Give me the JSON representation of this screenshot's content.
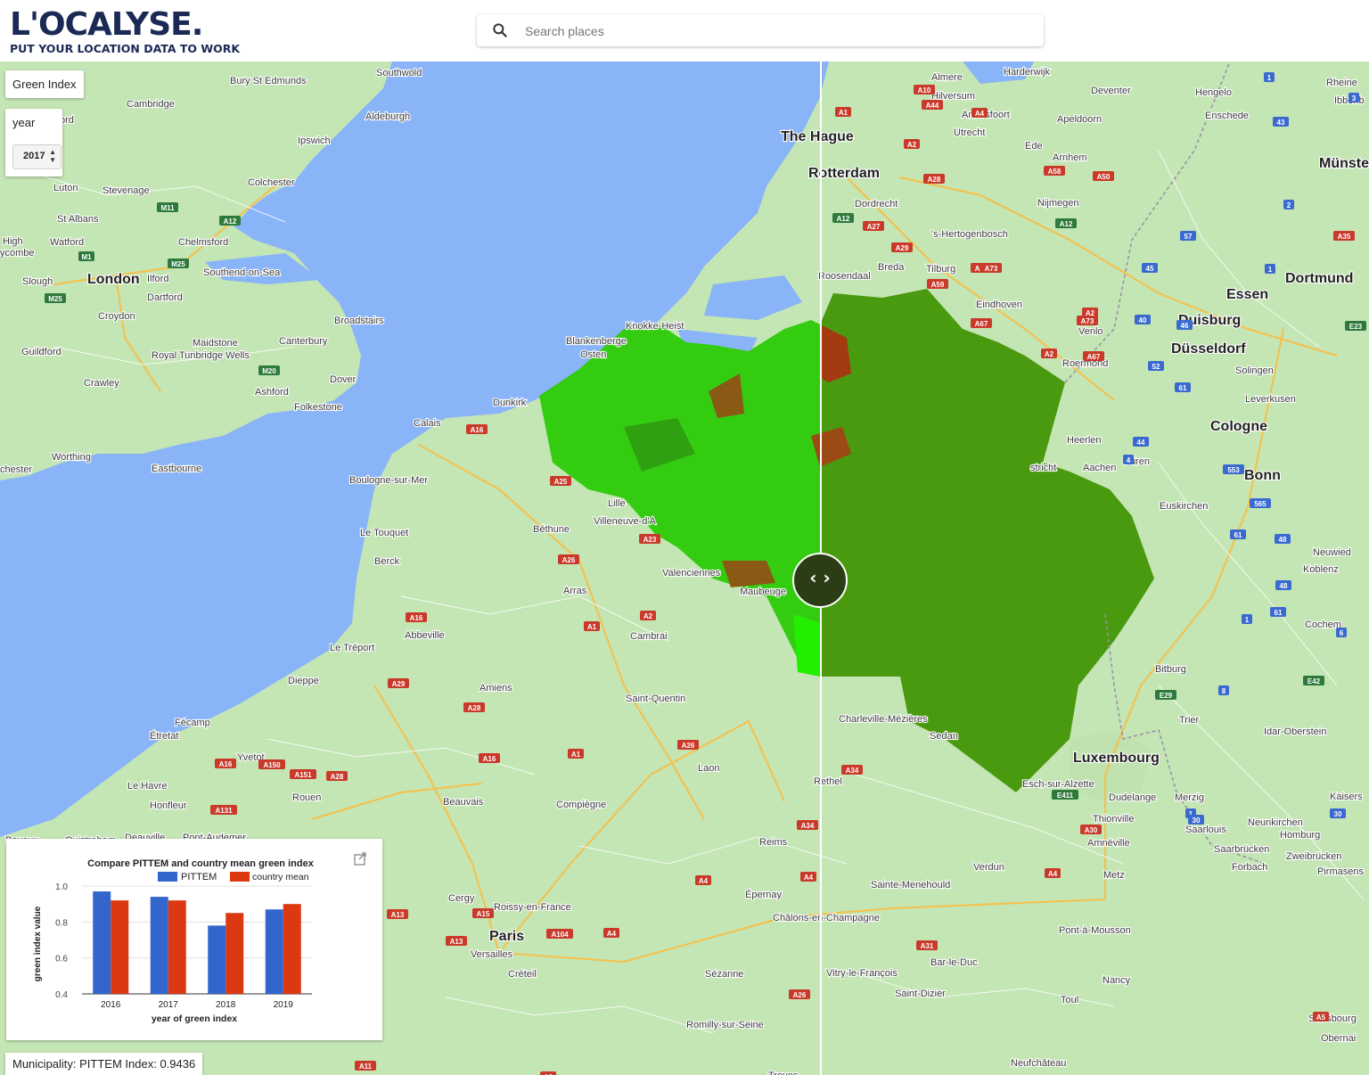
{
  "header": {
    "logo_text": "L'OCALYSE.",
    "tagline": "PUT YOUR LOCATION DATA TO WORK",
    "search_placeholder": "Search places"
  },
  "controls": {
    "layer_label": "Green Index",
    "year_label": "year",
    "year_value": "2017"
  },
  "status": {
    "municipality_text": "Municipality: PITTEM Index: 0.9436"
  },
  "map": {
    "labels": [
      {
        "text": "Cambridge",
        "big": false
      },
      {
        "text": "Bury St Edmunds",
        "big": false
      },
      {
        "text": "Southwold",
        "big": false
      },
      {
        "text": "Aldeburgh",
        "big": false
      },
      {
        "text": "Ipswich",
        "big": false
      },
      {
        "text": "Colchester",
        "big": false
      },
      {
        "text": "Luton",
        "big": false
      },
      {
        "text": "Stevenage",
        "big": false
      },
      {
        "text": "St Albans",
        "big": false
      },
      {
        "text": "Watford",
        "big": false
      },
      {
        "text": "Chelmsford",
        "big": false
      },
      {
        "text": "London",
        "big": true
      },
      {
        "text": "Slough",
        "big": false
      },
      {
        "text": "Ilford",
        "big": false
      },
      {
        "text": "Dartford",
        "big": false
      },
      {
        "text": "Southend-on-Sea",
        "big": false
      },
      {
        "text": "Croydon",
        "big": false
      },
      {
        "text": "Broadstairs",
        "big": false
      },
      {
        "text": "Maidstone",
        "big": false
      },
      {
        "text": "Canterbury",
        "big": false
      },
      {
        "text": "Guildford",
        "big": false
      },
      {
        "text": "Royal Tunbridge Wells",
        "big": false
      },
      {
        "text": "Crawley",
        "big": false
      },
      {
        "text": "Dover",
        "big": false
      },
      {
        "text": "Ashford",
        "big": false
      },
      {
        "text": "Folkestone",
        "big": false
      },
      {
        "text": "Worthing",
        "big": false
      },
      {
        "text": "Eastbourne",
        "big": false
      },
      {
        "text": "Calais",
        "big": false
      },
      {
        "text": "Dunkirk",
        "big": false
      },
      {
        "text": "Boulogne-sur-Mer",
        "big": false
      },
      {
        "text": "Le Touquet",
        "big": false
      },
      {
        "text": "Berck",
        "big": false
      },
      {
        "text": "Lille",
        "big": false
      },
      {
        "text": "Villeneuve-d'A",
        "big": false
      },
      {
        "text": "Béthune",
        "big": false
      },
      {
        "text": "Arras",
        "big": false
      },
      {
        "text": "Valenciennes",
        "big": false
      },
      {
        "text": "Maubeuge",
        "big": false
      },
      {
        "text": "Cambrai",
        "big": false
      },
      {
        "text": "Abbeville",
        "big": false
      },
      {
        "text": "Le Tréport",
        "big": false
      },
      {
        "text": "Dieppe",
        "big": false
      },
      {
        "text": "Amiens",
        "big": false
      },
      {
        "text": "Saint-Quentin",
        "big": false
      },
      {
        "text": "Fécamp",
        "big": false
      },
      {
        "text": "Étretat",
        "big": false
      },
      {
        "text": "Yvetot",
        "big": false
      },
      {
        "text": "Le Havre",
        "big": false
      },
      {
        "text": "Honfleur",
        "big": false
      },
      {
        "text": "Rouen",
        "big": false
      },
      {
        "text": "Beauvais",
        "big": false
      },
      {
        "text": "Compiègne",
        "big": false
      },
      {
        "text": "Laon",
        "big": false
      },
      {
        "text": "Reims",
        "big": false
      },
      {
        "text": "Cergy",
        "big": false
      },
      {
        "text": "Roissy-en-France",
        "big": false
      },
      {
        "text": "Paris",
        "big": true
      },
      {
        "text": "Versailles",
        "big": false
      },
      {
        "text": "Créteil",
        "big": false
      },
      {
        "text": "Épernay",
        "big": false
      },
      {
        "text": "Châlons-en-Champagne",
        "big": false
      },
      {
        "text": "Sézanne",
        "big": false
      },
      {
        "text": "Romilly-sur-Seine",
        "big": false
      },
      {
        "text": "Vitry-le-François",
        "big": false
      },
      {
        "text": "Saint-Dizier",
        "big": false
      },
      {
        "text": "Sainte-Menehould",
        "big": false
      },
      {
        "text": "Verdun",
        "big": false
      },
      {
        "text": "Metz",
        "big": false
      },
      {
        "text": "Pont-à-Mousson",
        "big": false
      },
      {
        "text": "Nancy",
        "big": false
      },
      {
        "text": "Toul",
        "big": false
      },
      {
        "text": "Bar-le-Duc",
        "big": false
      },
      {
        "text": "Sedan",
        "big": false
      },
      {
        "text": "Charleville-Mézières",
        "big": false
      },
      {
        "text": "Rethel",
        "big": false
      },
      {
        "text": "Luxembourg",
        "big": true
      },
      {
        "text": "Esch-sur-Alzette",
        "big": false
      },
      {
        "text": "Dudelange",
        "big": false
      },
      {
        "text": "Thionville",
        "big": false
      },
      {
        "text": "Amnéville",
        "big": false
      },
      {
        "text": "Merzig",
        "big": false
      },
      {
        "text": "Saarlouis",
        "big": false
      },
      {
        "text": "Saarbrücken",
        "big": false
      },
      {
        "text": "Forbach",
        "big": false
      },
      {
        "text": "Neunkirchen",
        "big": false
      },
      {
        "text": "Homburg",
        "big": false
      },
      {
        "text": "Zweibrücken",
        "big": false
      },
      {
        "text": "Pirmasens",
        "big": false
      },
      {
        "text": "Kaisers",
        "big": false
      },
      {
        "text": "Trier",
        "big": false
      },
      {
        "text": "Idar-Oberstein",
        "big": false
      },
      {
        "text": "Bitburg",
        "big": false
      },
      {
        "text": "Cochem",
        "big": false
      },
      {
        "text": "Koblenz",
        "big": false
      },
      {
        "text": "Neuwied",
        "big": false
      },
      {
        "text": "Bonn",
        "big": true
      },
      {
        "text": "Euskirchen",
        "big": false
      },
      {
        "text": "Cologne",
        "big": true
      },
      {
        "text": "Leverkusen",
        "big": false
      },
      {
        "text": "Solingen",
        "big": false
      },
      {
        "text": "Düsseldorf",
        "big": true
      },
      {
        "text": "Duisburg",
        "big": true
      },
      {
        "text": "Essen",
        "big": true
      },
      {
        "text": "Dortmund",
        "big": true
      },
      {
        "text": "Münste",
        "big": true
      },
      {
        "text": "Enschede",
        "big": false
      },
      {
        "text": "Hengelo",
        "big": false
      },
      {
        "text": "Rheine",
        "big": false
      },
      {
        "text": "Ibbenb",
        "big": false
      },
      {
        "text": "Deventer",
        "big": false
      },
      {
        "text": "Apeldoorn",
        "big": false
      },
      {
        "text": "Arnhem",
        "big": false
      },
      {
        "text": "Nijmegen",
        "big": false
      },
      {
        "text": "Ede",
        "big": false
      },
      {
        "text": "Amersfoort",
        "big": false
      },
      {
        "text": "Utrecht",
        "big": false
      },
      {
        "text": "Hilversum",
        "big": false
      },
      {
        "text": "Almere",
        "big": false
      },
      {
        "text": "Harderwijk",
        "big": false
      },
      {
        "text": "The Hague",
        "big": true
      },
      {
        "text": "Rotterdam",
        "big": true
      },
      {
        "text": "Dordrecht",
        "big": false
      },
      {
        "text": "'s-Hertogenbosch",
        "big": false
      },
      {
        "text": "Breda",
        "big": false
      },
      {
        "text": "Tilburg",
        "big": false
      },
      {
        "text": "Roosendaal",
        "big": false
      },
      {
        "text": "Eindhoven",
        "big": false
      },
      {
        "text": "Venlo",
        "big": false
      },
      {
        "text": "Roermond",
        "big": false
      },
      {
        "text": "Heerlen",
        "big": false
      },
      {
        "text": "Aachen",
        "big": false
      },
      {
        "text": "Düren",
        "big": false
      },
      {
        "text": "stricht",
        "big": false
      },
      {
        "text": "Knokke-Heist",
        "big": false
      },
      {
        "text": "Blankenberge",
        "big": false
      },
      {
        "text": "Osten",
        "big": false
      },
      {
        "text": "High",
        "big": false
      },
      {
        "text": "ycombe",
        "big": false
      },
      {
        "text": "chester",
        "big": false
      },
      {
        "text": "Bayeux",
        "big": false
      },
      {
        "text": "Ouistreham",
        "big": false
      },
      {
        "text": "Deauville",
        "big": false
      },
      {
        "text": "Pont-Audemer",
        "big": false
      },
      {
        "text": "Neufchâteau",
        "big": false
      },
      {
        "text": "Troyes",
        "big": false
      },
      {
        "text": "Strasbourg",
        "big": false
      },
      {
        "text": "Obernai",
        "big": false
      },
      {
        "text": "ord",
        "big": false
      }
    ],
    "roads": [
      "M11",
      "A12",
      "M1",
      "M25",
      "M25",
      "M20",
      "A16",
      "A25",
      "A26",
      "A23",
      "A16",
      "A2",
      "A1",
      "A28",
      "A29",
      "A16",
      "A150",
      "A151",
      "A28",
      "A131",
      "A1",
      "A26",
      "A16",
      "A34",
      "A4",
      "A4",
      "A13",
      "A15",
      "A104",
      "A13",
      "A4",
      "A26",
      "A34",
      "A4",
      "A31",
      "A11",
      "A6",
      "A5",
      "E411",
      "A30",
      "E29",
      "E42",
      "A10",
      "A1",
      "A44",
      "A4",
      "A2",
      "A28",
      "A12",
      "A27",
      "A29",
      "A16",
      "A59",
      "A58",
      "A50",
      "A12",
      "A73",
      "A2",
      "A67",
      "A73",
      "A67",
      "A2",
      "40",
      "46",
      "52",
      "61",
      "44",
      "4",
      "553",
      "565",
      "61",
      "48",
      "48",
      "61",
      "1",
      "6",
      "8",
      "1",
      "30",
      "30",
      "1",
      "3",
      "43",
      "57",
      "2",
      "45",
      "1",
      "A35",
      "E23"
    ]
  },
  "chart": {
    "title": "Compare PITTEM and country mean green index",
    "external_link_icon": "external-link-icon",
    "colors": {
      "pittem": "#3366cc",
      "country": "#dc3912"
    },
    "chart_data": {
      "type": "bar",
      "title": "Compare PITTEM and country mean green index",
      "xlabel": "year of green index",
      "ylabel": "green index value",
      "categories": [
        "2016",
        "2017",
        "2018",
        "2019"
      ],
      "series": [
        {
          "name": "PITTEM",
          "values": [
            0.97,
            0.94,
            0.78,
            0.87
          ]
        },
        {
          "name": "country mean",
          "values": [
            0.92,
            0.92,
            0.85,
            0.9
          ]
        }
      ],
      "ylim": [
        0.4,
        1.0
      ],
      "yticks": [
        "1.0",
        "0.8",
        "0.6",
        "0.4"
      ],
      "legend": "top"
    }
  }
}
